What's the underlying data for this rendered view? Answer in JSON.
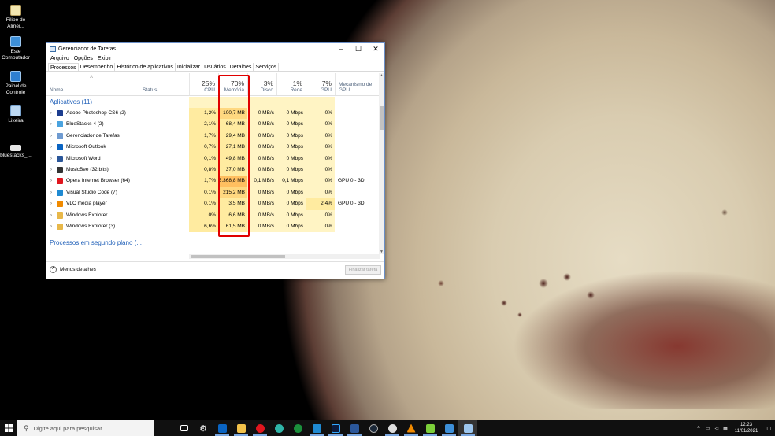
{
  "desktop": {
    "icons": [
      {
        "label": "Filipe de Almei...",
        "icon": "file-icon"
      },
      {
        "label": "Este Computador",
        "icon": "computer-icon"
      },
      {
        "label": "Painel de Controle",
        "icon": "control-panel-icon"
      },
      {
        "label": "Lixeira",
        "icon": "recycle-bin-icon"
      },
      {
        "label": "bluestacks_...",
        "icon": "file-icon"
      }
    ]
  },
  "window": {
    "title": "Gerenciador de Tarefas",
    "menu": [
      "Arquivo",
      "Opções",
      "Exibir"
    ],
    "tabs": [
      "Processos",
      "Desempenho",
      "Histórico de aplicativos",
      "Inicializar",
      "Usuários",
      "Detalhes",
      "Serviços"
    ],
    "columns": {
      "name": "Nome",
      "status": "Status",
      "cpu": {
        "pct": "25%",
        "label": "CPU"
      },
      "mem": {
        "pct": "70%",
        "label": "Memória"
      },
      "disk": {
        "pct": "3%",
        "label": "Disco"
      },
      "net": {
        "pct": "1%",
        "label": "Rede"
      },
      "gpu": {
        "pct": "7%",
        "label": "GPU"
      },
      "engine": "Mecanismo de GPU"
    },
    "group_apps": "Aplicativos (11)",
    "group_bg": "Processos em segundo plano (...",
    "rows": [
      {
        "name": "Adobe Photoshop CS6 (2)",
        "cpu": "1,2%",
        "mem": "100,7 MB",
        "disk": "0 MB/s",
        "net": "0 Mbps",
        "gpu": "0%",
        "engine": "",
        "color": "#1c3d8f"
      },
      {
        "name": "BlueStacks 4 (2)",
        "cpu": "2,1%",
        "mem": "68,4 MB",
        "disk": "0 MB/s",
        "net": "0 Mbps",
        "gpu": "0%",
        "engine": "",
        "color": "#4aa3df"
      },
      {
        "name": "Gerenciador de Tarefas",
        "cpu": "1,7%",
        "mem": "29,4 MB",
        "disk": "0 MB/s",
        "net": "0 Mbps",
        "gpu": "0%",
        "engine": "",
        "color": "#6f9bd1"
      },
      {
        "name": "Microsoft Outlook",
        "cpu": "0,7%",
        "mem": "27,1 MB",
        "disk": "0 MB/s",
        "net": "0 Mbps",
        "gpu": "0%",
        "engine": "",
        "color": "#0a64c2"
      },
      {
        "name": "Microsoft Word",
        "cpu": "0,1%",
        "mem": "49,8 MB",
        "disk": "0 MB/s",
        "net": "0 Mbps",
        "gpu": "0%",
        "engine": "",
        "color": "#2b579a"
      },
      {
        "name": "MusicBee (32 bits)",
        "cpu": "0,8%",
        "mem": "37,0 MB",
        "disk": "0 MB/s",
        "net": "0 Mbps",
        "gpu": "0%",
        "engine": "",
        "color": "#333333"
      },
      {
        "name": "Opera Internet Browser (64)",
        "cpu": "1,7%",
        "mem": "3.368,8 MB",
        "disk": "0,1 MB/s",
        "net": "0,1 Mbps",
        "gpu": "0%",
        "engine": "GPU 0 - 3D",
        "color": "#e0161e"
      },
      {
        "name": "Visual Studio Code (7)",
        "cpu": "0,1%",
        "mem": "215,2 MB",
        "disk": "0 MB/s",
        "net": "0 Mbps",
        "gpu": "0%",
        "engine": "",
        "color": "#1f8ad2"
      },
      {
        "name": "VLC media player",
        "cpu": "0,1%",
        "mem": "3,5 MB",
        "disk": "0 MB/s",
        "net": "0 Mbps",
        "gpu": "2,4%",
        "engine": "GPU 0 - 3D",
        "color": "#f08a00"
      },
      {
        "name": "Windows Explorer",
        "cpu": "0%",
        "mem": "6,6 MB",
        "disk": "0 MB/s",
        "net": "0 Mbps",
        "gpu": "0%",
        "engine": "",
        "color": "#e8b84a"
      },
      {
        "name": "Windows Explorer (3)",
        "cpu": "6,6%",
        "mem": "61,5 MB",
        "disk": "0 MB/s",
        "net": "0 Mbps",
        "gpu": "0%",
        "engine": "",
        "color": "#e8b84a"
      }
    ],
    "less_details": "Menos detalhes",
    "end_task": "Finalizar tarefa"
  },
  "taskbar": {
    "search_placeholder": "Digite aqui para pesquisar",
    "time": "12:23",
    "date": "11/01/2021"
  }
}
